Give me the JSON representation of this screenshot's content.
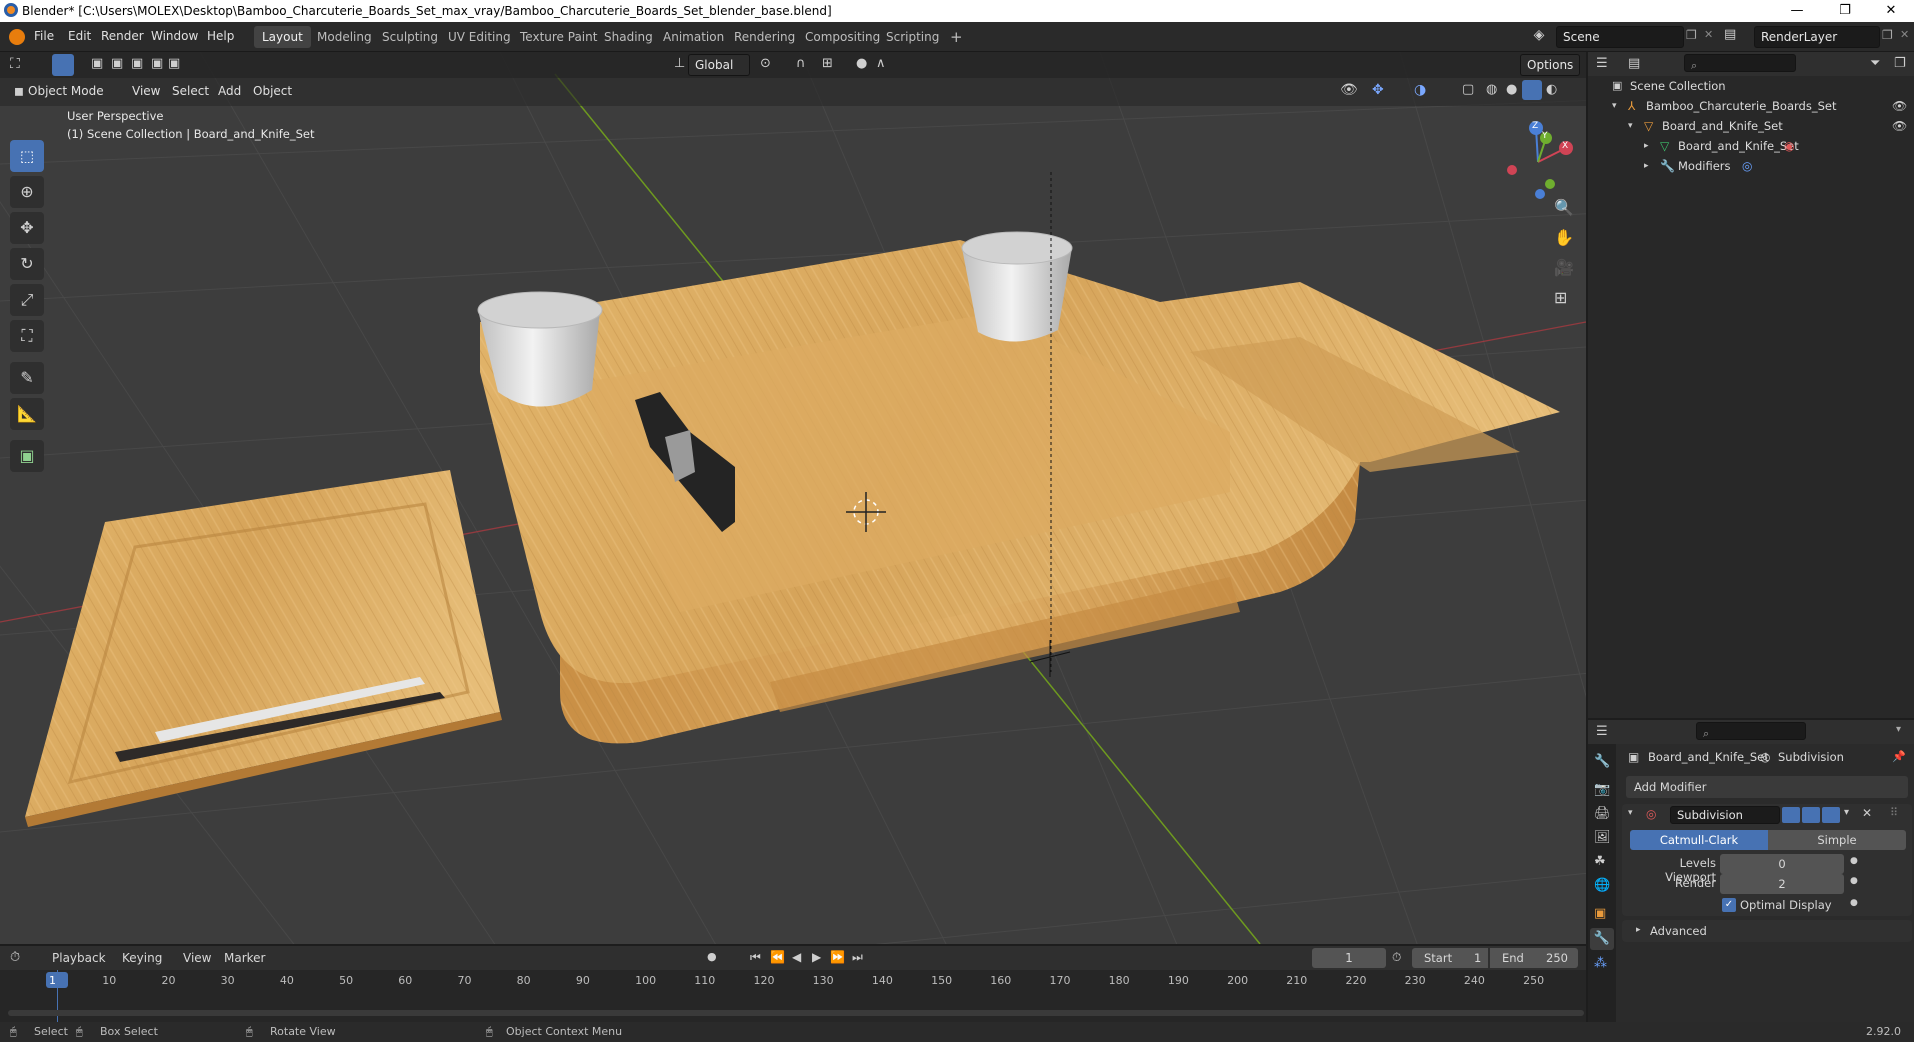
{
  "window": {
    "title": "Blender* [C:\\Users\\MOLEX\\Desktop\\Bamboo_Charcuterie_Boards_Set_max_vray/Bamboo_Charcuterie_Boards_Set_blender_base.blend]",
    "minimize": "—",
    "maximize": "❐",
    "close": "✕"
  },
  "menubar": {
    "items": [
      "File",
      "Edit",
      "Render",
      "Window",
      "Help"
    ]
  },
  "workspaces": [
    "Layout",
    "Modeling",
    "Sculpting",
    "UV Editing",
    "Texture Paint",
    "Shading",
    "Animation",
    "Rendering",
    "Compositing",
    "Scripting"
  ],
  "workspace_add": "+",
  "scene": {
    "name": "Scene",
    "render_layer": "RenderLayer"
  },
  "viewport_header": {
    "mode": "Object Mode",
    "menus": [
      "View",
      "Select",
      "Add",
      "Object"
    ],
    "transform_orientation": "Global",
    "options": "Options"
  },
  "viewport": {
    "perspective": "User Perspective",
    "collection_info": "(1) Scene Collection | Board_and_Knife_Set",
    "gizmo": {
      "x": "X",
      "y": "Y",
      "z": "Z"
    }
  },
  "outliner": {
    "root": "Scene Collection",
    "items": [
      {
        "label": "Bamboo_Charcuterie_Boards_Set"
      },
      {
        "label": "Board_and_Knife_Set"
      },
      {
        "label": "Board_and_Knife_Set"
      },
      {
        "label": "Modifiers"
      }
    ]
  },
  "properties": {
    "object_name": "Board_and_Knife_Set",
    "modifier_tab": "Subdivision",
    "add_modifier": "Add Modifier",
    "modifier_name": "Subdivision",
    "type_buttons": [
      "Catmull-Clark",
      "Simple"
    ],
    "levels_viewport_label": "Levels Viewport",
    "levels_viewport_value": "0",
    "render_label": "Render",
    "render_value": "2",
    "optimal_display": "Optimal Display",
    "advanced": "Advanced"
  },
  "timeline": {
    "menus": [
      "Playback",
      "Keying",
      "View",
      "Marker"
    ],
    "current_frame": "1",
    "start_label": "Start",
    "start_value": "1",
    "end_label": "End",
    "end_value": "250",
    "ruler": [
      "1",
      "10",
      "20",
      "30",
      "40",
      "50",
      "60",
      "70",
      "80",
      "90",
      "100",
      "110",
      "120",
      "130",
      "140",
      "150",
      "160",
      "170",
      "180",
      "190",
      "200",
      "210",
      "220",
      "230",
      "240",
      "250"
    ]
  },
  "statusbar": {
    "select": "Select",
    "box_select": "Box Select",
    "rotate_view": "Rotate View",
    "context_menu": "Object Context Menu",
    "version": "2.92.0"
  },
  "colors": {
    "accent": "#4772b3",
    "bamboo": "#d9a95f",
    "bamboo_dark": "#b98540",
    "grid": "#484848",
    "x_axis": "#a83a40",
    "y_axis": "#6e9a1f"
  }
}
